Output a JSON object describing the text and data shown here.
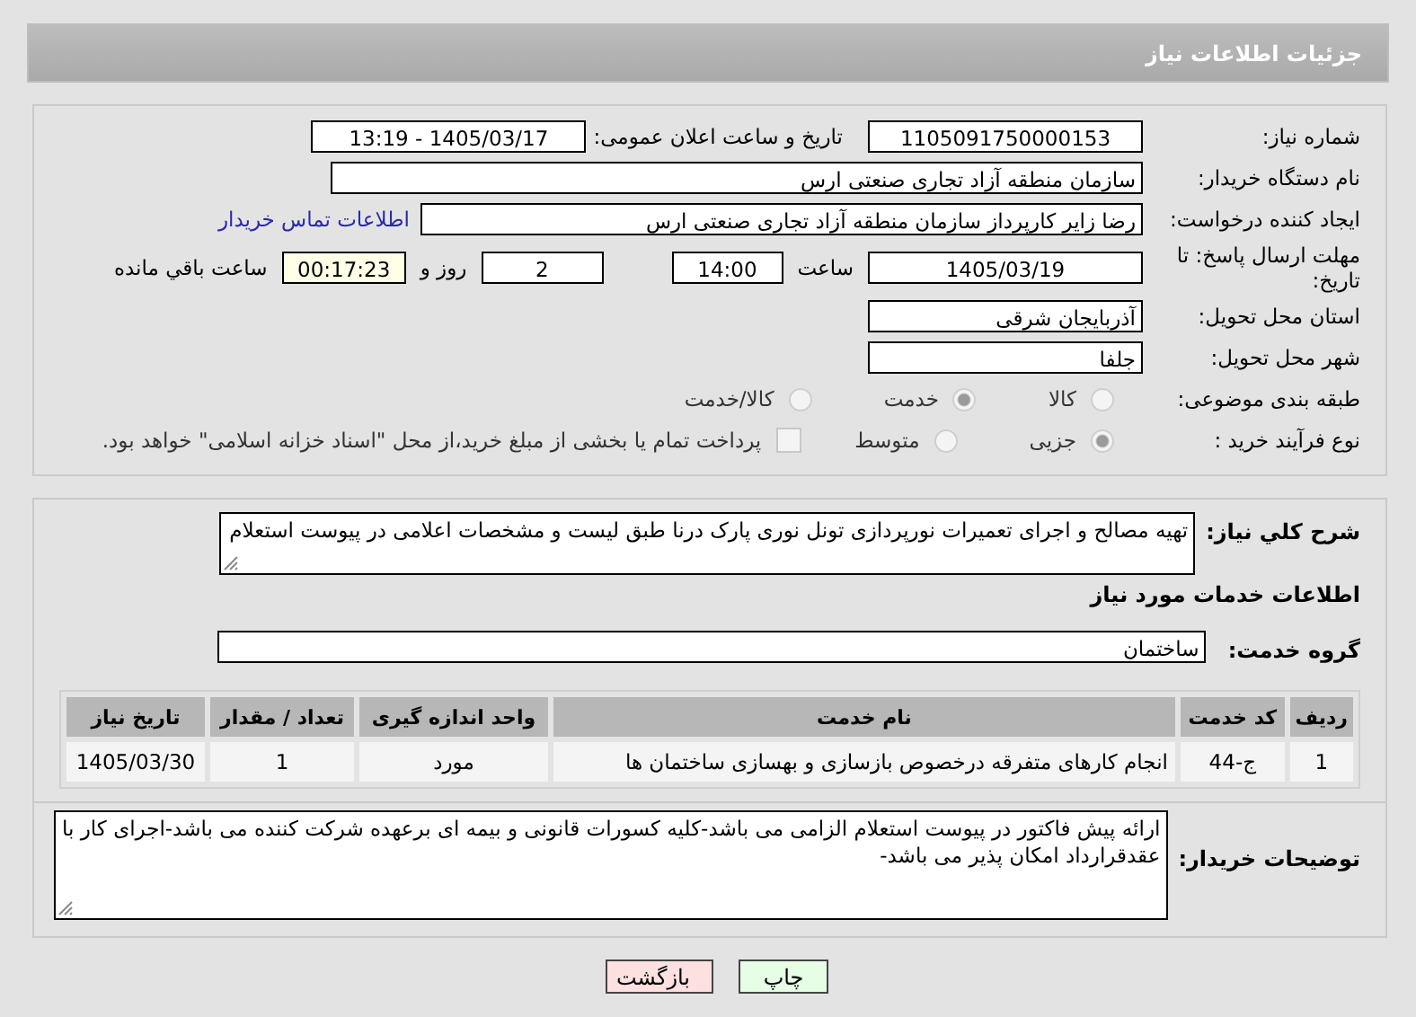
{
  "header": {
    "title": "جزئیات اطلاعات نیاز"
  },
  "need_number": {
    "label": "شماره نیاز:",
    "value": "1105091750000153"
  },
  "announce": {
    "label": "تاریخ و ساعت اعلان عمومی:",
    "value": "1405/03/17 - 13:19"
  },
  "buyer_org": {
    "label": "نام دستگاه خریدار:",
    "value": "سازمان منطقه آزاد تجاری صنعتی ارس"
  },
  "creator": {
    "label": "ایجاد کننده درخواست:",
    "value": "رضا زایر کارپرداز سازمان منطقه آزاد تجاری صنعتی ارس",
    "link": "اطلاعات تماس خریدار"
  },
  "deadline": {
    "label": "مهلت ارسال پاسخ: تا تاریخ:",
    "date": "1405/03/19",
    "time_label": "ساعت",
    "time": "14:00",
    "days": "2",
    "days_label": "روز و",
    "remaining": "00:17:23",
    "remaining_label": "ساعت باقي مانده"
  },
  "province": {
    "label": "استان محل تحویل:",
    "value": "آذربایجان شرقی"
  },
  "city": {
    "label": "شهر محل تحویل:",
    "value": "جلفا"
  },
  "category": {
    "label": "طبقه بندی موضوعی:",
    "options": [
      {
        "label": "کالا",
        "selected": false
      },
      {
        "label": "خدمت",
        "selected": true
      },
      {
        "label": "کالا/خدمت",
        "selected": false
      }
    ]
  },
  "purchase_type": {
    "label": "نوع فرآیند خرید :",
    "options": [
      {
        "label": "جزیی",
        "selected": true
      },
      {
        "label": "متوسط",
        "selected": false
      }
    ],
    "payment_checkbox": {
      "checked": false,
      "label": "پرداخت تمام یا بخشی از مبلغ خرید،از محل \"اسناد خزانه اسلامی\" خواهد بود."
    }
  },
  "description": {
    "label": "شرح كلي نياز:",
    "value": "تهیه مصالح و اجرای تعمیرات نورپردازی تونل نوری پارک درنا طبق لیست و مشخصات اعلامی در پیوست استعلام"
  },
  "services_heading": "اطلاعات خدمات مورد نیاز",
  "service_group": {
    "label": "گروه خدمت:",
    "value": "ساختمان"
  },
  "table": {
    "columns": [
      "ردیف",
      "کد خدمت",
      "نام خدمت",
      "واحد اندازه گیری",
      "تعداد / مقدار",
      "تاریخ نیاز"
    ],
    "rows": [
      [
        "1",
        "ج-44",
        "انجام کارهای متفرقه درخصوص بازسازی و بهسازی ساختمان ها",
        "مورد",
        "1",
        "1405/03/30"
      ]
    ]
  },
  "buyer_notes": {
    "label": "توضیحات خریدار:",
    "value": "ارائه پیش فاکتور در پیوست استعلام الزامی می باشد-کلیه کسورات قانونی و بیمه ای برعهده شرکت کننده می باشد-اجرای کار با عقدقرارداد امکان پذیر می باشد-"
  },
  "buttons": [
    {
      "label": "چاپ",
      "kind": "print"
    },
    {
      "label": "بازگشت",
      "kind": "back"
    }
  ]
}
